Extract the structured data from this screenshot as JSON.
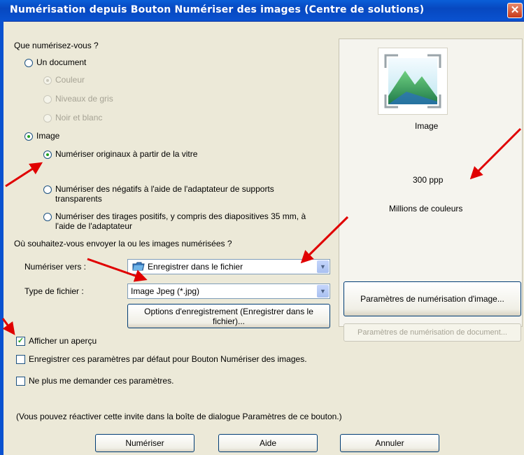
{
  "window": {
    "title": "Numérisation depuis Bouton Numériser des images (Centre de solutions)",
    "close_glyph": "✕"
  },
  "question1": "Que numérisez-vous ?",
  "doc_option": "Un document",
  "color_options": [
    "Couleur",
    "Niveaux de gris",
    "Noir et blanc"
  ],
  "image_option": "Image",
  "image_sources": [
    "Numériser originaux à partir de la vitre",
    [
      "Numériser des négatifs à l'aide de l'adaptateur de supports",
      "transparents"
    ],
    [
      "Numériser des tirages positifs, y compris des diapositives 35 mm, à",
      "l'aide de l'adaptateur"
    ]
  ],
  "question2": "Où souhaitez-vous envoyer la ou les images numérisées ?",
  "scan_to_label": "Numériser vers :",
  "scan_to_value": "Enregistrer dans le fichier",
  "file_type_label": "Type de fichier :",
  "file_type_value": "Image Jpeg (*.jpg)",
  "save_options_button": [
    "Options d'enregistrement (Enregistrer dans le",
    "fichier)..."
  ],
  "checkboxes": [
    {
      "label": "Afficher un aperçu",
      "checked": true
    },
    {
      "label": "Enregistrer ces paramètres par défaut pour Bouton Numériser des images.",
      "checked": false
    },
    {
      "label": "Ne plus me demander ces paramètres.",
      "checked": false
    }
  ],
  "hint": "(Vous pouvez réactiver cette invite dans la boîte de dialogue Paramètres de ce bouton.)",
  "preview": {
    "type_label": "Image",
    "resolution": "300 ppp",
    "colors": "Millions de couleurs"
  },
  "image_settings_button": "Paramètres de numérisation d'image...",
  "document_settings_button": "Paramètres de numérisation de document...",
  "buttons": {
    "scan": "Numériser",
    "help": "Aide",
    "cancel": "Annuler"
  },
  "annotation_color": "#e00000"
}
